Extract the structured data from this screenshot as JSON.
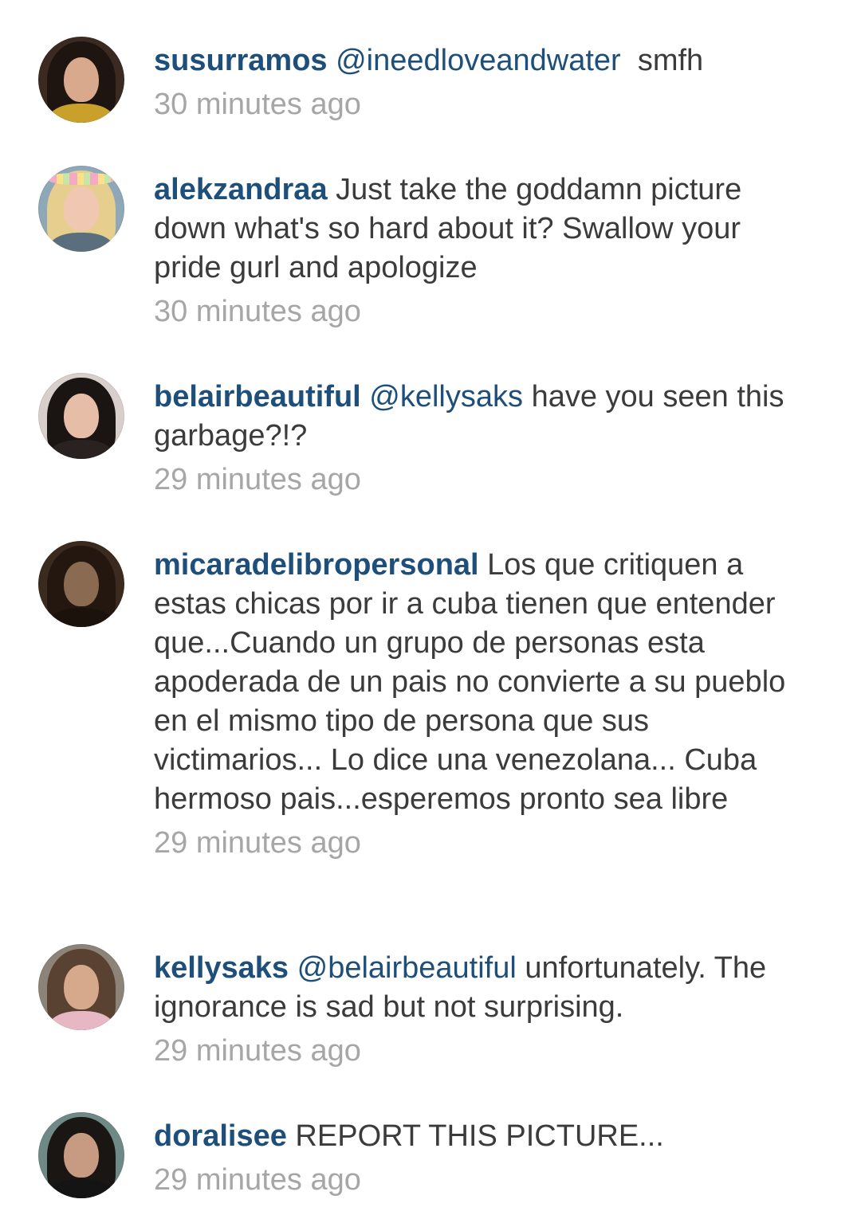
{
  "comments": [
    {
      "avatar_icon": "user-avatar-photo",
      "username": "susurramos",
      "mention": "@ineedloveandwater",
      "text": "  smfh",
      "time": "30 minutes ago"
    },
    {
      "avatar_icon": "user-avatar-photo",
      "username": "alekzandraa",
      "mention": "",
      "text": " Just take the goddamn picture down what's so hard about it? Swallow your pride gurl and apologize",
      "time": "30 minutes ago"
    },
    {
      "avatar_icon": "user-avatar-photo",
      "username": "belairbeautiful",
      "mention": "@kellysaks",
      "text": " have you seen this garbage?!?",
      "time": "29 minutes ago"
    },
    {
      "avatar_icon": "user-avatar-photo",
      "username": "micaradelibropersonal",
      "mention": "",
      "text": " Los que critiquen a estas chicas por ir a cuba tienen que entender que...Cuando un grupo de personas esta apoderada de un pais no convierte a su pueblo en el mismo tipo de persona que sus victimarios... Lo dice una venezolana... Cuba hermoso pais...esperemos pronto sea libre",
      "time": "29 minutes ago"
    },
    {
      "avatar_icon": "user-avatar-photo",
      "username": "kellysaks",
      "mention": "@belairbeautiful",
      "text": " unfortunately. The ignorance is sad but not surprising.",
      "time": "29 minutes ago"
    },
    {
      "avatar_icon": "user-avatar-photo",
      "username": "doralisee",
      "mention": "",
      "text": " REPORT THIS PICTURE...",
      "time": "29 minutes ago"
    }
  ],
  "colors": {
    "username": "#1d4f7a",
    "body_text": "#3b3b3b",
    "timestamp": "#a6a6a6",
    "background": "#ffffff"
  }
}
